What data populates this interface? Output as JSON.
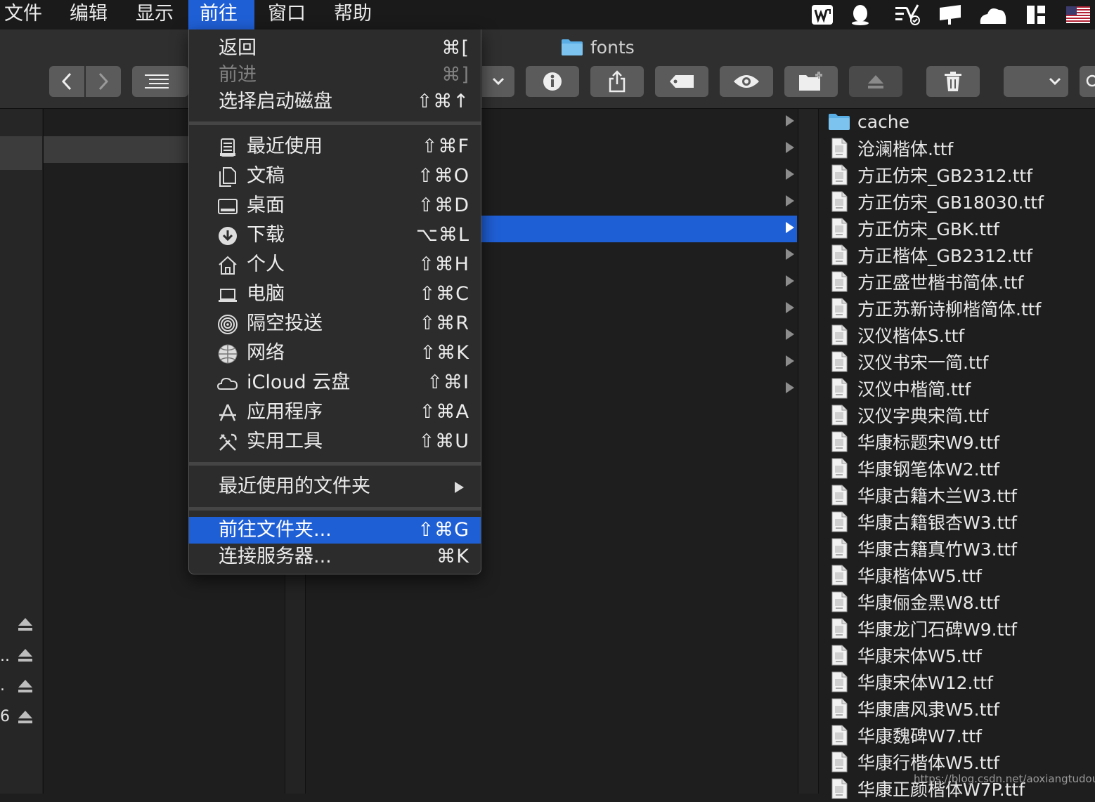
{
  "menubar": {
    "items": [
      "文件",
      "编辑",
      "显示",
      "前往",
      "窗口",
      "帮助"
    ],
    "active_index": 3
  },
  "window": {
    "title": "fonts"
  },
  "go_menu": {
    "nav": [
      {
        "label": "返回",
        "shortcut": "⌘[",
        "enabled": true
      },
      {
        "label": "前进",
        "shortcut": "⌘]",
        "enabled": false
      },
      {
        "label": "选择启动磁盘",
        "shortcut": "⇧⌘↑",
        "enabled": true
      }
    ],
    "places": [
      {
        "label": "最近使用",
        "shortcut": "⇧⌘F",
        "icon": "recents-icon"
      },
      {
        "label": "文稿",
        "shortcut": "⇧⌘O",
        "icon": "documents-icon"
      },
      {
        "label": "桌面",
        "shortcut": "⇧⌘D",
        "icon": "desktop-icon"
      },
      {
        "label": "下载",
        "shortcut": "⌥⌘L",
        "icon": "downloads-icon"
      },
      {
        "label": "个人",
        "shortcut": "⇧⌘H",
        "icon": "home-icon"
      },
      {
        "label": "电脑",
        "shortcut": "⇧⌘C",
        "icon": "computer-icon"
      },
      {
        "label": "隔空投送",
        "shortcut": "⇧⌘R",
        "icon": "airdrop-icon"
      },
      {
        "label": "网络",
        "shortcut": "⇧⌘K",
        "icon": "network-icon"
      },
      {
        "label": "iCloud 云盘",
        "shortcut": "⇧⌘I",
        "icon": "icloud-icon"
      },
      {
        "label": "应用程序",
        "shortcut": "⇧⌘A",
        "icon": "applications-icon"
      },
      {
        "label": "实用工具",
        "shortcut": "⇧⌘U",
        "icon": "utilities-icon"
      }
    ],
    "recent_folders": {
      "label": "最近使用的文件夹"
    },
    "goto_folder": {
      "label": "前往文件夹...",
      "shortcut": "⇧⌘G",
      "highlighted": true
    },
    "connect_server": {
      "label": "连接服务器...",
      "shortcut": "⌘K"
    }
  },
  "sidebar": {
    "truncated_labels": [
      "..",
      ".",
      "6"
    ]
  },
  "files": [
    {
      "name": "cache",
      "type": "folder"
    },
    {
      "name": "沧澜楷体.ttf",
      "type": "font"
    },
    {
      "name": "方正仿宋_GB2312.ttf",
      "type": "font"
    },
    {
      "name": "方正仿宋_GB18030.ttf",
      "type": "font"
    },
    {
      "name": "方正仿宋_GBK.ttf",
      "type": "font"
    },
    {
      "name": "方正楷体_GB2312.ttf",
      "type": "font"
    },
    {
      "name": "方正盛世楷书简体.ttf",
      "type": "font"
    },
    {
      "name": "方正苏新诗柳楷简体.ttf",
      "type": "font"
    },
    {
      "name": "汉仪楷体S.ttf",
      "type": "font"
    },
    {
      "name": "汉仪书宋一简.ttf",
      "type": "font"
    },
    {
      "name": "汉仪中楷简.ttf",
      "type": "font"
    },
    {
      "name": "汉仪字典宋简.ttf",
      "type": "font"
    },
    {
      "name": "华康标题宋W9.ttf",
      "type": "font"
    },
    {
      "name": "华康钢笔体W2.ttf",
      "type": "font"
    },
    {
      "name": "华康古籍木兰W3.ttf",
      "type": "font"
    },
    {
      "name": "华康古籍银杏W3.ttf",
      "type": "font"
    },
    {
      "name": "华康古籍真竹W3.ttf",
      "type": "font"
    },
    {
      "name": "华康楷体W5.ttf",
      "type": "font"
    },
    {
      "name": "华康俪金黑W8.ttf",
      "type": "font"
    },
    {
      "name": "华康龙门石碑W9.ttf",
      "type": "font"
    },
    {
      "name": "华康宋体W5.ttf",
      "type": "font"
    },
    {
      "name": "华康宋体W12.ttf",
      "type": "font"
    },
    {
      "name": "华康唐风隶W5.ttf",
      "type": "font"
    },
    {
      "name": "华康魏碑W7.ttf",
      "type": "font"
    },
    {
      "name": "华康行楷体W5.ttf",
      "type": "font"
    },
    {
      "name": "华康正颜楷体W7P.ttf",
      "type": "font"
    }
  ],
  "watermark": "https://blog.csdn.net/aoxiangtudou",
  "colors": {
    "accent": "#1f5fd6",
    "menu_bg": "#2c2c2c",
    "toolbar_bg": "#2f2f2f",
    "folder": "#5aaee6"
  }
}
